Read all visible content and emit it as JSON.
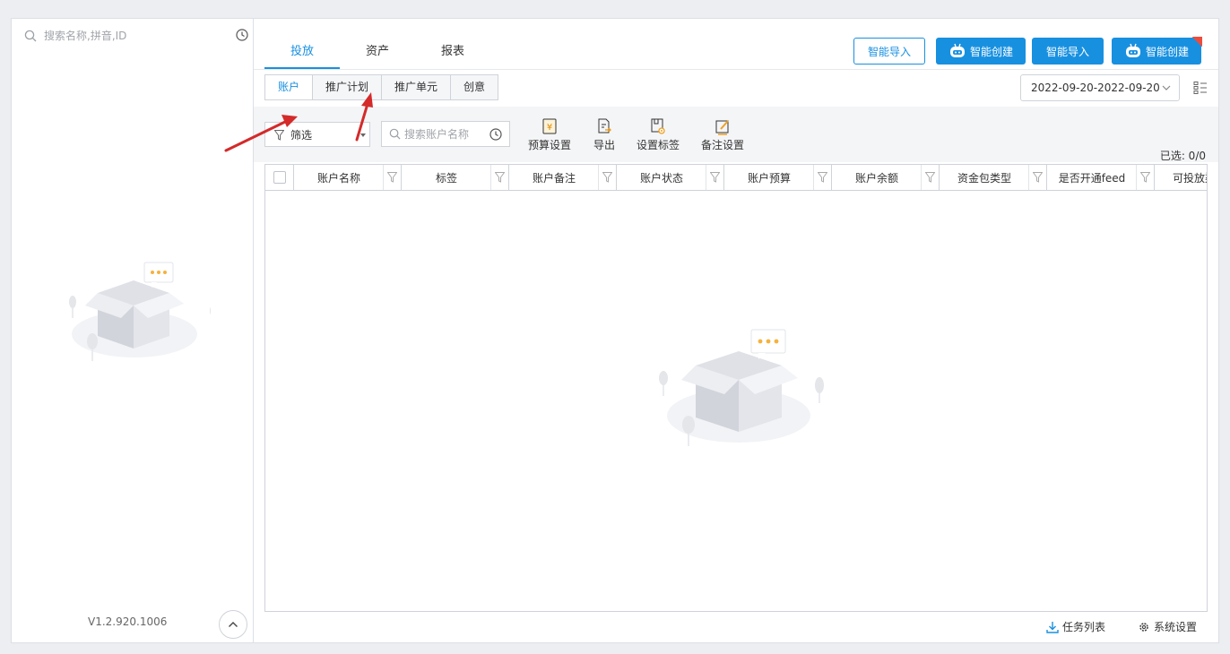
{
  "sidebar": {
    "search_placeholder": "搜索名称,拼音,ID",
    "version": "V1.2.920.1006"
  },
  "top_tabs": [
    {
      "label": "投放",
      "active": true
    },
    {
      "label": "资产",
      "active": false
    },
    {
      "label": "报表",
      "active": false
    }
  ],
  "header_buttons": {
    "smart_import_1": "智能导入",
    "smart_create_1": "智能创建",
    "smart_import_2": "智能导入",
    "smart_create_2": "智能创建"
  },
  "sub_tabs": [
    {
      "label": "账户",
      "active": true
    },
    {
      "label": "推广计划",
      "active": false
    },
    {
      "label": "推广单元",
      "active": false
    },
    {
      "label": "创意",
      "active": false
    }
  ],
  "date_range": "2022-09-20-2022-09-20",
  "toolbar": {
    "filter_value": "筛选",
    "search_placeholder": "搜索账户名称",
    "budget_settings": "预算设置",
    "export": "导出",
    "set_tags": "设置标签",
    "remark_settings": "备注设置"
  },
  "selected_label": "已选: 0/0",
  "table": {
    "columns": [
      "账户名称",
      "标签",
      "账户备注",
      "账户状态",
      "账户预算",
      "账户余额",
      "资金包类型",
      "是否开通feed",
      "可投放渠道"
    ]
  },
  "footer": {
    "task_list": "任务列表",
    "system_settings": "系统设置"
  },
  "colors": {
    "accent": "#1890e0",
    "arrow": "#d42a2a",
    "new_badge": "#f04b3a"
  }
}
